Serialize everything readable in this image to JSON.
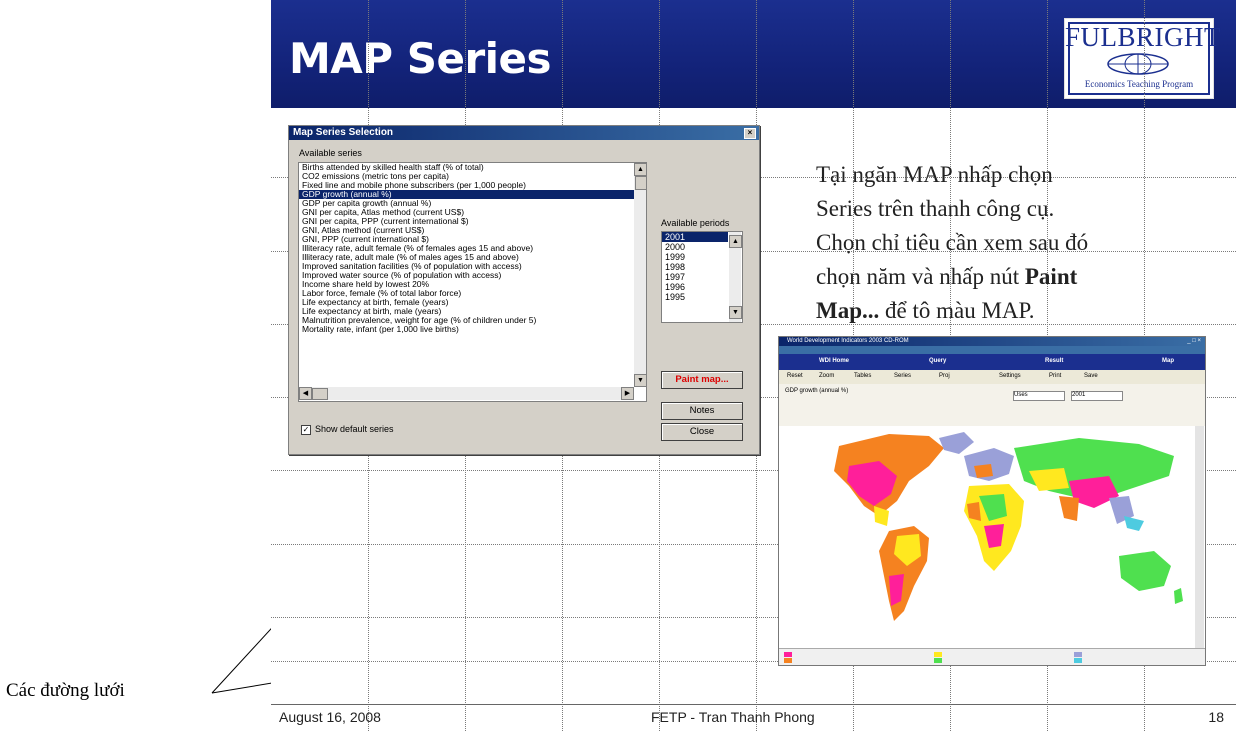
{
  "slide": {
    "title": "MAP Series",
    "footer_date": "August 16, 2008",
    "footer_center": "FETP - Tran Thanh Phong",
    "footer_page": "18"
  },
  "logo": {
    "word": "FULBRIGHT",
    "sub": "Economics Teaching Program",
    "color": "#1b2f8f"
  },
  "dialog": {
    "title": "Map Series Selection",
    "available_series_label": "Available series",
    "series": [
      "Births attended by skilled health staff (% of total)",
      "CO2 emissions (metric tons per capita)",
      "Fixed line and mobile phone subscribers (per 1,000 people)",
      "GDP growth (annual %)",
      "GDP per capita growth (annual %)",
      "GNI per capita, Atlas method (current US$)",
      "GNI per capita, PPP (current international $)",
      "GNI, Atlas method (current US$)",
      "GNI, PPP (current international $)",
      "Illiteracy rate, adult female (% of females ages 15 and above)",
      "Illiteracy rate, adult male (% of males ages 15 and above)",
      "Improved sanitation facilities (% of population with access)",
      "Improved water source (% of population with access)",
      "Income share held by lowest 20%",
      "Labor force, female (% of total labor force)",
      "Life expectancy at birth, female (years)",
      "Life expectancy at birth, male (years)",
      "Malnutrition prevalence, weight for age (% of children under 5)",
      "Mortality rate, infant (per 1,000 live births)"
    ],
    "selected_series": "GDP growth (annual %)",
    "available_periods_label": "Available periods",
    "periods": [
      "2001",
      "2000",
      "1999",
      "1998",
      "1997",
      "1996",
      "1995"
    ],
    "selected_period": "2001",
    "paint_button": "Paint map...",
    "notes_button": "Notes",
    "close_button": "Close",
    "show_default_label": "Show default series",
    "show_default_checked": true
  },
  "body_text": {
    "line1": "Tại ngăn MAP nhấp chọn",
    "line2": "Series trên thanh công cụ.",
    "line3": "Chọn chỉ tiêu cần xem sau đó",
    "line4a": "chọn năm và nhấp nút ",
    "line4b": "Paint",
    "line5a": "Map...",
    "line5b": " để tô màu MAP."
  },
  "screenshot": {
    "window_title": "World Development Indicators 2003 CD-ROM",
    "tabs": [
      "WDI Home",
      "Query",
      "Result",
      "Map"
    ],
    "toolbar": [
      "Reset",
      "Zoom",
      "Tables",
      "Series",
      "Proj",
      "Settings",
      "Print",
      "Save"
    ],
    "map_label": "GDP growth (annual %)",
    "period": "2001",
    "unit": "Uses"
  },
  "callout": {
    "label": "Các đường lưới"
  }
}
